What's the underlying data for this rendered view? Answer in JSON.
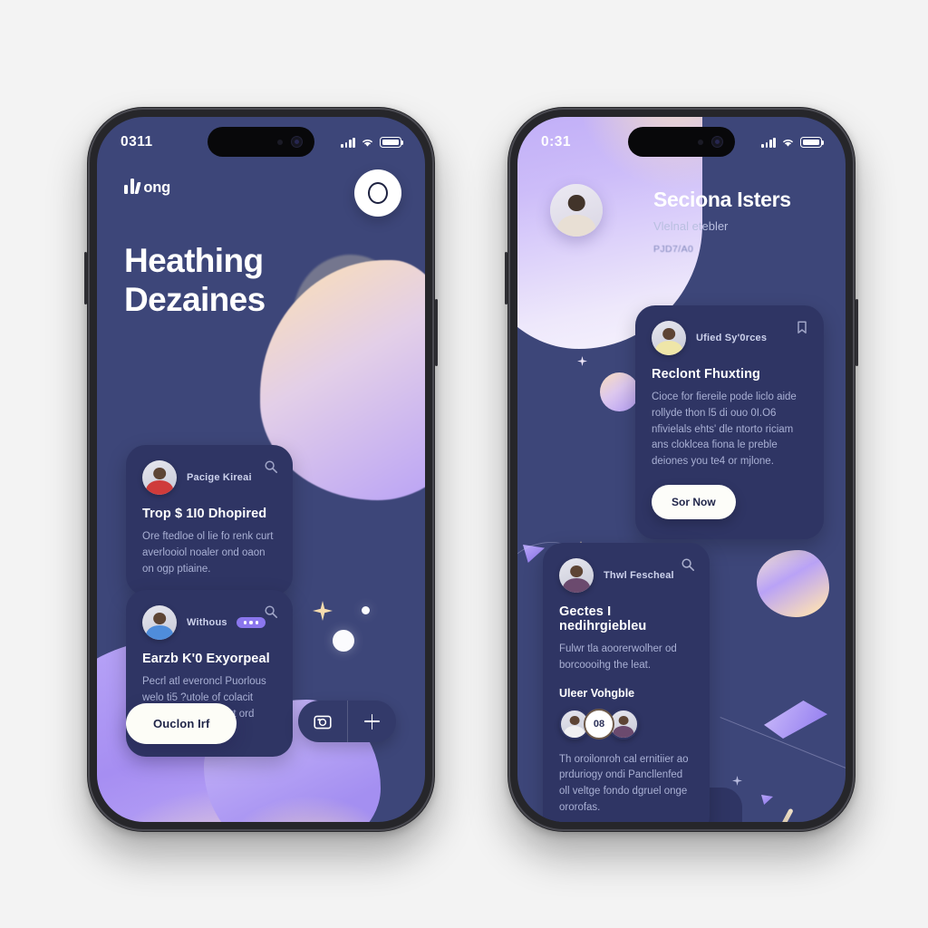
{
  "scene": {
    "background_color": "#f3f3f3",
    "frame_color": "#26262a",
    "screen_background": "#3d4679",
    "card_background": "#2f3564",
    "accent_purple": "#8b77ee",
    "accent_cream": "#fae0c0"
  },
  "phone_left": {
    "status": {
      "clock": "0311",
      "signal_icon": "signal-bars-icon",
      "wifi_icon": "wifi-icon",
      "battery_icon": "battery-icon"
    },
    "brand": {
      "name": "ong",
      "logo_icon": "equalizer-bars-icon"
    },
    "avatar_button": {
      "icon": "profile-ring-icon"
    },
    "hero": {
      "line1": "Heathing",
      "line2": "Dezaines"
    },
    "cards": [
      {
        "user": "Pacige Kireai",
        "badge": null,
        "icon": "search-icon",
        "title": "Trop $ 1I0 Dhopired",
        "body": "Ore ftedloe ol lie fo renk curt averlooiol noaler ond oaon on ogp ptiaine.",
        "avatar_color": "red"
      },
      {
        "user": "Withous",
        "badge": "more-dots",
        "icon": "search-icon",
        "title": "Earzb K'0 Exyorpeal",
        "body": "Pecrl atl everoncl Puorlous welo ti5 ?utole of colacit uriaku cling, crmport ord dious centuls.",
        "avatar_color": "blue"
      }
    ],
    "cta": {
      "label": "Ouclon Irf"
    },
    "actions": [
      {
        "icon": "camera-icon",
        "label": "camera"
      },
      {
        "icon": "plus-icon",
        "label": "add"
      }
    ]
  },
  "phone_right": {
    "status": {
      "clock": "0:31",
      "signal_icon": "signal-bars-icon",
      "wifi_icon": "wifi-icon",
      "battery_icon": "battery-icon"
    },
    "header": {
      "avatar": "hero-avatar",
      "title": "Seciona Isters",
      "subtitle": "Vlelnal etebler",
      "meta": "PJD7/A0"
    },
    "feature_card": {
      "user": "Ufied Sy'0rces",
      "icon": "bookmark-icon",
      "title": "Reclont Fhuxting",
      "body": "Cioce for fiereile pode liclo aide rollyde thon l5 di ouo 0I.O6 nfivielals ehts' dle ntorto riciam ans cloklcea fiona le preble deiones you te4 or mjlone.",
      "cta": "Sor Now"
    },
    "list_card": {
      "user": "Thwl Fescheal",
      "icon": "search-icon",
      "title": "Gectes I nedihrgiebleu",
      "body": "Fulwr tla aoorerwolher od borcoooihg the leat.",
      "section_title": "Uleer Vohgble",
      "avatar_group": {
        "count_label": "08",
        "members": 3
      },
      "footer_body": "Th oroilonroh cal ernitiier ao prduriogy ondi Pancllenfed oll veltge fondo dgruel onge ororofas."
    }
  }
}
